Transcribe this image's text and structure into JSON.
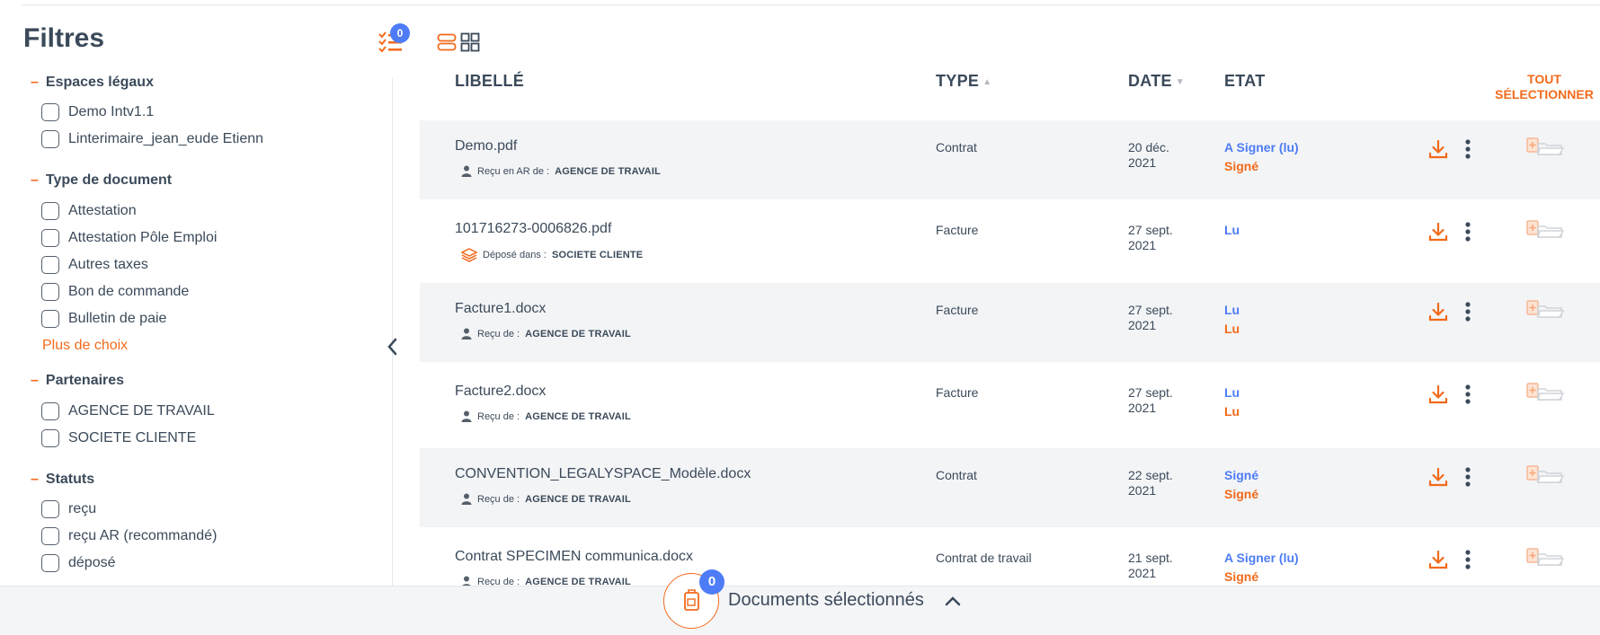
{
  "sidebar": {
    "title": "Filtres",
    "active_filters_count": "0",
    "groups": [
      {
        "label": "Espaces légaux",
        "options": [
          "Demo Intv1.1",
          "Linterimaire_jean_eude Etienn"
        ]
      },
      {
        "label": "Type de document",
        "options": [
          "Attestation",
          "Attestation Pôle Emploi",
          "Autres taxes",
          "Bon de commande",
          "Bulletin de paie"
        ],
        "more": "Plus de choix"
      },
      {
        "label": "Partenaires",
        "options": [
          "AGENCE DE TRAVAIL",
          "SOCIETE CLIENTE"
        ]
      },
      {
        "label": "Statuts",
        "options": [
          "reçu",
          "reçu AR (recommandé)",
          "déposé"
        ]
      }
    ]
  },
  "table": {
    "headers": {
      "libelle": "LIBELLÉ",
      "type": "TYPE",
      "date": "DATE",
      "etat": "ETAT"
    },
    "select_all": "TOUT SÉLECTIONNER",
    "rows": [
      {
        "name": "Demo.pdf",
        "sub_label": "Reçu en AR de :",
        "sub_value": "AGENCE DE TRAVAIL",
        "sub_icon": "person-icon",
        "type": "Contrat",
        "date": "20 déc. 2021",
        "status1": "A Signer (lu)",
        "status2": "Signé"
      },
      {
        "name": "101716273-0006826.pdf",
        "sub_label": "Déposé dans :",
        "sub_value": "SOCIETE CLIENTE",
        "sub_icon": "layers-icon",
        "type": "Facture",
        "date": "27 sept. 2021",
        "status1": "Lu",
        "status2": ""
      },
      {
        "name": "Facture1.docx",
        "sub_label": "Reçu de :",
        "sub_value": "AGENCE DE TRAVAIL",
        "sub_icon": "person-icon",
        "type": "Facture",
        "date": "27 sept. 2021",
        "status1": "Lu",
        "status2": "Lu"
      },
      {
        "name": "Facture2.docx",
        "sub_label": "Reçu de :",
        "sub_value": "AGENCE DE TRAVAIL",
        "sub_icon": "person-icon",
        "type": "Facture",
        "date": "27 sept. 2021",
        "status1": "Lu",
        "status2": "Lu"
      },
      {
        "name": "CONVENTION_LEGALYSPACE_Modèle.docx",
        "sub_label": "Reçu de :",
        "sub_value": "AGENCE DE TRAVAIL",
        "sub_icon": "person-icon",
        "type": "Contrat",
        "date": "22 sept. 2021",
        "status1": "Signé",
        "status2": "Signé"
      },
      {
        "name": "Contrat SPECIMEN communica.docx",
        "sub_label": "Reçu de :",
        "sub_value": "AGENCE DE TRAVAIL",
        "sub_icon": "person-icon",
        "type": "Contrat de travail",
        "date": "21 sept. 2021",
        "status1": "A Signer (lu)",
        "status2": "Signé"
      }
    ]
  },
  "bottom_bar": {
    "label": "Documents sélectionnés",
    "count": "0"
  },
  "colors": {
    "accent": "#f26a1b",
    "blue": "#4d7cf6",
    "text": "#3b4a5a",
    "row_alt": "#f3f4f6"
  }
}
